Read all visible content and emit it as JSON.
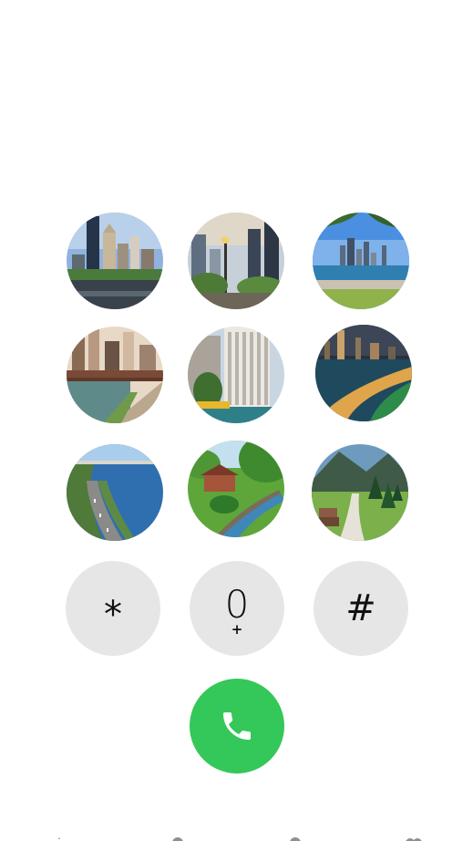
{
  "dialer": {
    "photo_keys": [
      {
        "name": "keypad-1",
        "scene": "downtown-skyscrapers-river"
      },
      {
        "name": "keypad-2",
        "scene": "city-skyline-park"
      },
      {
        "name": "keypad-3",
        "scene": "lakefront-skyline"
      },
      {
        "name": "keypad-4",
        "scene": "river-bridge-walk"
      },
      {
        "name": "keypad-5",
        "scene": "white-tower-riverfront"
      },
      {
        "name": "keypad-6",
        "scene": "night-lakeside-path"
      },
      {
        "name": "keypad-7",
        "scene": "coastal-highway"
      },
      {
        "name": "keypad-8",
        "scene": "garden-canal"
      },
      {
        "name": "keypad-9",
        "scene": "mountain-meadow-trail"
      }
    ],
    "star_label": "*",
    "zero_label": "0",
    "zero_sub_label": "+",
    "hash_label": "#",
    "call_icon": "phone-icon",
    "colors": {
      "call_button": "#34c759",
      "key_background": "#e6e6e6"
    }
  },
  "tab_bar": {
    "icons": [
      "favorites-icon",
      "recents-icon",
      "contacts-icon",
      "voicemail-icon"
    ]
  }
}
